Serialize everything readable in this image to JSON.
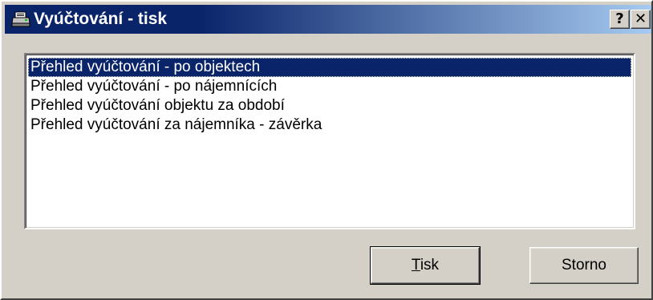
{
  "window": {
    "title": "Vyúčtování - tisk",
    "title_icon": "printer-icon",
    "help_label": "?",
    "close_label": "✕"
  },
  "list": {
    "items": [
      "Přehled vyúčtování - po objektech",
      "Přehled vyúčtování - po nájemnících",
      "Přehled vyúčtování objektu za období",
      "Přehled vyúčtování za nájemníka - závěrka"
    ],
    "selected_index": 0
  },
  "buttons": {
    "print_accel": "T",
    "print_rest": "isk",
    "cancel_label": "Storno"
  },
  "colors": {
    "title_gradient_start": "#0a246a",
    "title_gradient_end": "#a6caf0",
    "face": "#d4d0c8",
    "selection": "#0a246a"
  }
}
